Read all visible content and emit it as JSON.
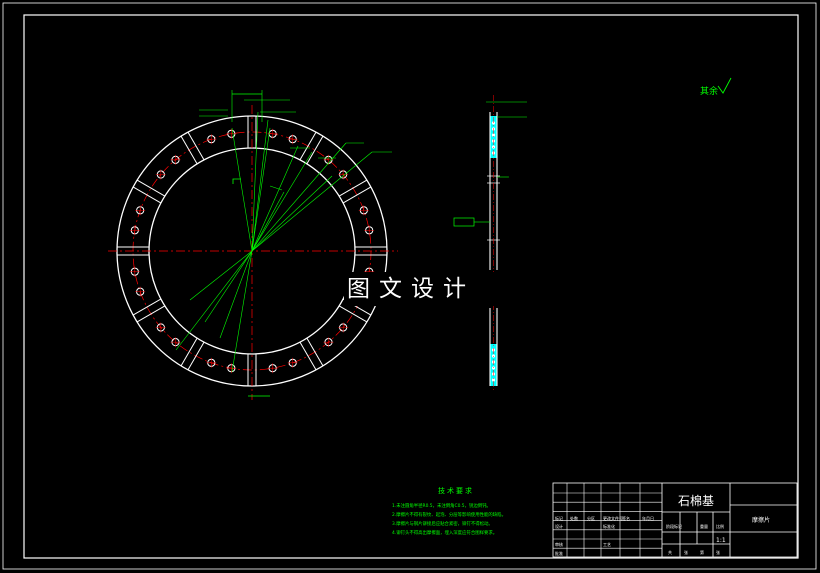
{
  "watermark": "图文设计",
  "drawing": {
    "roughness_label": "其余",
    "material": "石棉基",
    "part_name": "摩擦片",
    "scale": "1:1"
  },
  "tech_requirements": {
    "title": "技术要求",
    "items": [
      "1.未注圆角半径R0.5，未注倒角C0.5，锐边倒钝。",
      "2.摩擦片不得有裂纹、起泡、分层等影响使用性能的缺陷。",
      "3.摩擦片与钢片铆接后应贴合紧密，铆钉不得松动。",
      "4.铆钉头不得高出摩擦面，埋入深度应符合图样要求。"
    ]
  },
  "title_block": {
    "left_labels": [
      "标记",
      "处数",
      "分区",
      "更改文件号",
      "签名",
      "年月日",
      "设计",
      "标准化",
      "审核",
      "工艺",
      "批准"
    ],
    "mid_labels": [
      "阶段标记",
      "重量",
      "比例",
      "共",
      "张",
      "第",
      "张"
    ]
  },
  "colors": {
    "background": "#000000",
    "outline": "#ffffff",
    "centerline": "#ff0000",
    "dimension": "#00ff00",
    "hatch": "#00ffff",
    "border": "#ffffff"
  }
}
